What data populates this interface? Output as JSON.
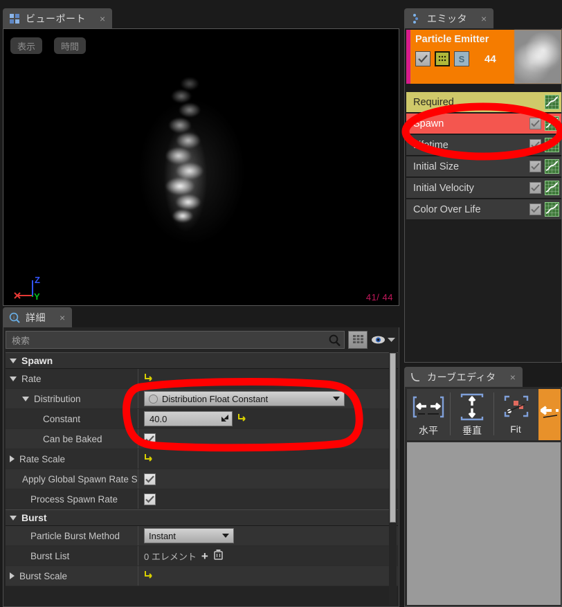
{
  "app": {
    "theme_bg": "#1b1b1b",
    "accent_orange": "#f57c00",
    "accent_magenta": "#d81b8a",
    "annotation_color": "#ff0000"
  },
  "viewport": {
    "tab": {
      "label": "ビューポート",
      "close": "×",
      "icon": "grid-panel-icon"
    },
    "buttons": [
      {
        "name": "display",
        "label": "表示"
      },
      {
        "name": "time",
        "label": "時間"
      }
    ],
    "axis_gizmo": {
      "x_label": "X",
      "x_color": "#e53935",
      "y_label": "Y",
      "y_color": "#00c020",
      "z_label": "Z",
      "z_color": "#3355ff"
    },
    "particle_count": "41/ 44",
    "particle_count_color": "#c2185b"
  },
  "emitter_panel": {
    "tab": {
      "label": "エミッタ",
      "close": "×",
      "icon": "emitter-icon"
    },
    "header": {
      "title": "Particle Emitter",
      "count": "44",
      "enabled_check": "✓",
      "solo_label": "S",
      "bg_color": "#f57c00",
      "stripe_color": "#d81b8a"
    },
    "modules": [
      {
        "label": "Required",
        "bg": "#cfc96a",
        "fg": "#2a2a20",
        "checked": false,
        "has_check": false,
        "graph": true
      },
      {
        "label": "Spawn",
        "bg": "#f4564f",
        "fg": "#ffffff",
        "checked": true,
        "has_check": true,
        "graph": true
      },
      {
        "label": "Lifetime",
        "bg": "#3a3a3a",
        "fg": "#d6d6d6",
        "checked": true,
        "has_check": true,
        "graph": true
      },
      {
        "label": "Initial Size",
        "bg": "#3a3a3a",
        "fg": "#d6d6d6",
        "checked": true,
        "has_check": true,
        "graph": true
      },
      {
        "label": "Initial Velocity",
        "bg": "#3a3a3a",
        "fg": "#d6d6d6",
        "checked": true,
        "has_check": true,
        "graph": true
      },
      {
        "label": "Color Over Life",
        "bg": "#3a3a3a",
        "fg": "#d6d6d6",
        "checked": true,
        "has_check": true,
        "graph": true
      }
    ]
  },
  "details_panel": {
    "tab": {
      "label": "詳細",
      "close": "×",
      "icon": "info-icon"
    },
    "search": {
      "placeholder": "検索",
      "value": ""
    },
    "toolbar_icons": [
      "search-icon",
      "grid-view-icon",
      "eye-icon",
      "chevron-down-icon"
    ],
    "categories": [
      {
        "name": "Spawn",
        "expanded": true,
        "rows": [
          {
            "label": "Rate",
            "indent": 1,
            "tri": "down",
            "control": "reset"
          },
          {
            "label": "Distribution",
            "indent": 2,
            "tri": "down",
            "control": "combo",
            "value": "Distribution Float Constant"
          },
          {
            "label": "Constant",
            "indent": 3,
            "tri": "none",
            "control": "number",
            "value": "40.0",
            "reset": true
          },
          {
            "label": "Can be Baked",
            "indent": 3,
            "tri": "none",
            "control": "checkbox",
            "checked": true
          },
          {
            "label": "Rate Scale",
            "indent": 1,
            "tri": "right",
            "control": "reset"
          },
          {
            "label": "Apply Global Spawn Rate S",
            "indent": 2,
            "tri": "none",
            "control": "checkbox",
            "checked": true
          },
          {
            "label": "Process Spawn Rate",
            "indent": 2,
            "tri": "none",
            "control": "checkbox",
            "checked": true
          }
        ]
      },
      {
        "name": "Burst",
        "expanded": true,
        "rows": [
          {
            "label": "Particle Burst Method",
            "indent": 2,
            "tri": "none",
            "control": "combo2",
            "value": "Instant"
          },
          {
            "label": "Burst List",
            "indent": 2,
            "tri": "none",
            "control": "elements",
            "value": "0 エレメント",
            "add": "+",
            "delete": "delete-icon"
          },
          {
            "label": "Burst Scale",
            "indent": 1,
            "tri": "right",
            "control": "reset"
          }
        ]
      }
    ]
  },
  "curve_editor": {
    "tab": {
      "label": "カーブエディタ",
      "close": "×",
      "icon": "curve-icon"
    },
    "buttons": [
      {
        "name": "horizontal",
        "label": "水平",
        "icon": "fit-horizontal-icon"
      },
      {
        "name": "vertical",
        "label": "垂直",
        "icon": "fit-vertical-icon"
      },
      {
        "name": "fit",
        "label": "Fit",
        "icon": "fit-all-icon"
      }
    ],
    "overflow_button": {
      "name": "fit-selected",
      "icon": "fit-selected-icon",
      "bg": "#e8912a"
    }
  },
  "annotations": [
    {
      "name": "spawn-module-highlight",
      "shape": "ellipse"
    },
    {
      "name": "distribution-value-highlight",
      "shape": "rounded-rect"
    }
  ]
}
